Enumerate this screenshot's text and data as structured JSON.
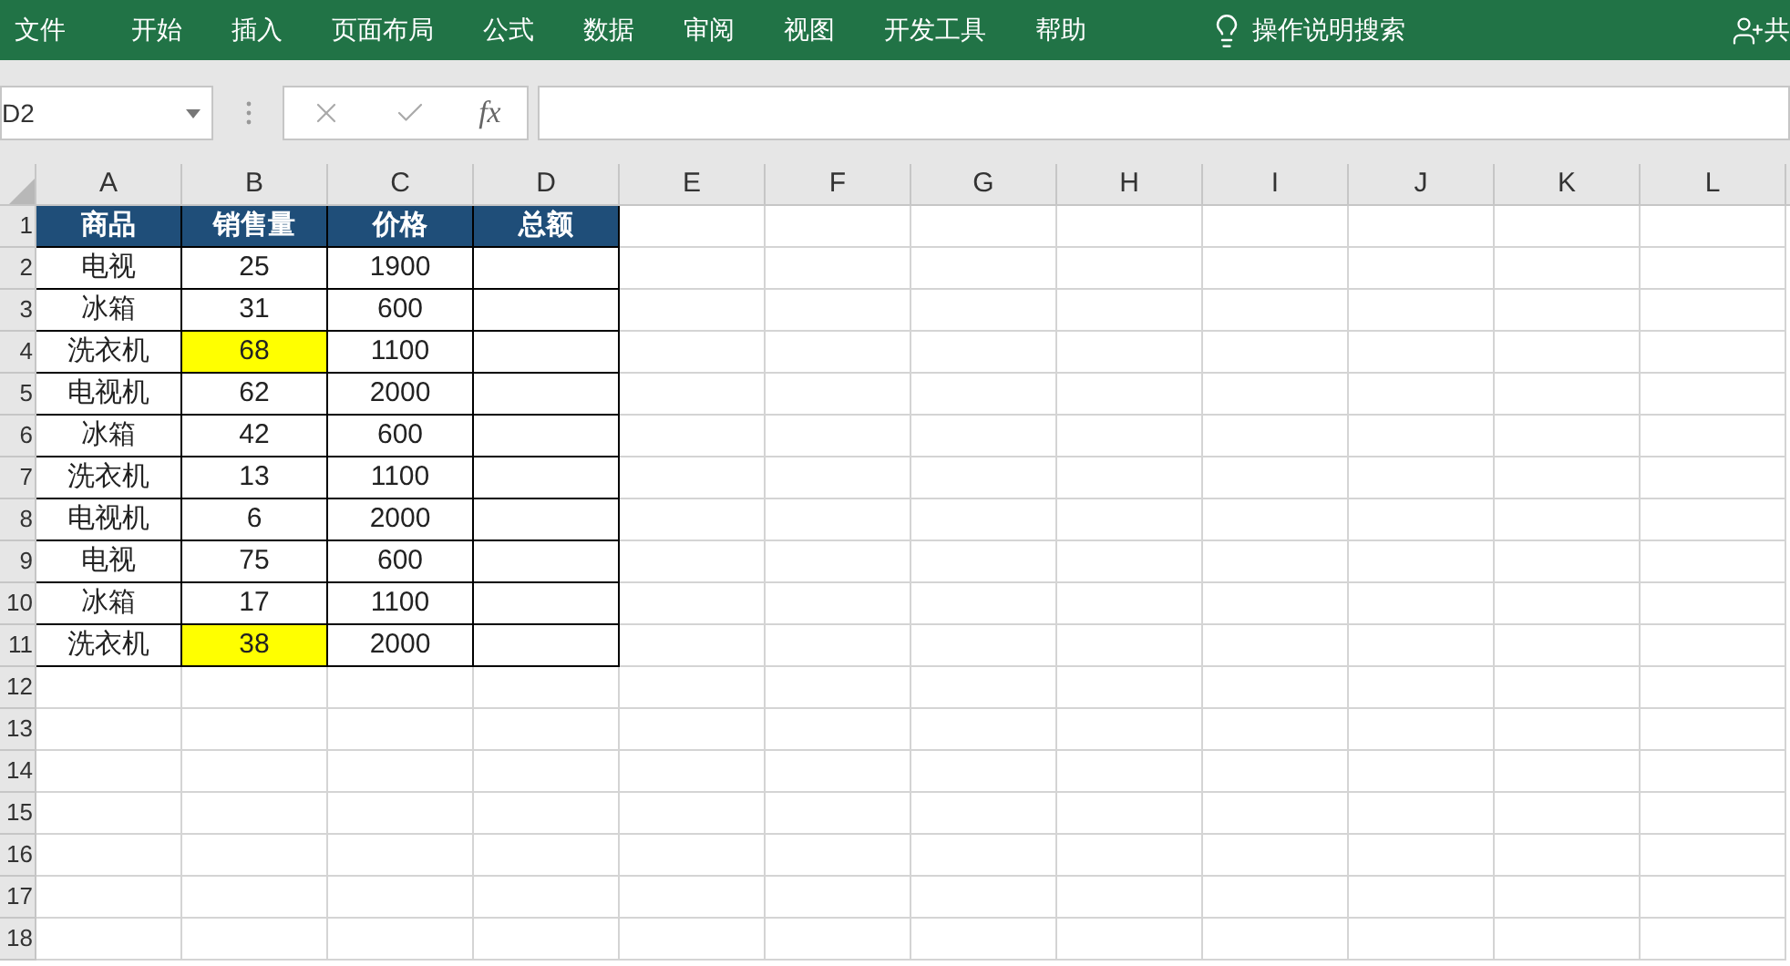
{
  "menu": [
    "文件",
    "开始",
    "插入",
    "页面布局",
    "公式",
    "数据",
    "审阅",
    "视图",
    "开发工具",
    "帮助"
  ],
  "tell_me": "操作说明搜索",
  "share": "共",
  "name_box": "D2",
  "function_label": "fx",
  "columns": [
    "A",
    "B",
    "C",
    "D",
    "E",
    "F",
    "G",
    "H",
    "I",
    "J",
    "K",
    "L"
  ],
  "header_row": {
    "number": "1",
    "cells": [
      "商品",
      "销售量",
      "价格",
      "总额"
    ]
  },
  "rows": [
    {
      "number": "2",
      "cells": [
        {
          "text": "电视",
          "highlighted": false
        },
        {
          "text": "25",
          "highlighted": false
        },
        {
          "text": "1900",
          "highlighted": false
        }
      ]
    },
    {
      "number": "3",
      "cells": [
        {
          "text": "冰箱",
          "highlighted": false
        },
        {
          "text": "31",
          "highlighted": false
        },
        {
          "text": "600",
          "highlighted": false
        }
      ]
    },
    {
      "number": "4",
      "cells": [
        {
          "text": "洗衣机",
          "highlighted": false
        },
        {
          "text": "68",
          "highlighted": true
        },
        {
          "text": "1100",
          "highlighted": false
        }
      ]
    },
    {
      "number": "5",
      "cells": [
        {
          "text": "电视机",
          "highlighted": false
        },
        {
          "text": "62",
          "highlighted": false
        },
        {
          "text": "2000",
          "highlighted": false
        }
      ]
    },
    {
      "number": "6",
      "cells": [
        {
          "text": "冰箱",
          "highlighted": false
        },
        {
          "text": "42",
          "highlighted": false
        },
        {
          "text": "600",
          "highlighted": false
        }
      ]
    },
    {
      "number": "7",
      "cells": [
        {
          "text": "洗衣机",
          "highlighted": false
        },
        {
          "text": "13",
          "highlighted": false
        },
        {
          "text": "1100",
          "highlighted": false
        }
      ]
    },
    {
      "number": "8",
      "cells": [
        {
          "text": "电视机",
          "highlighted": false
        },
        {
          "text": "6",
          "highlighted": false
        },
        {
          "text": "2000",
          "highlighted": false
        }
      ]
    },
    {
      "number": "9",
      "cells": [
        {
          "text": "电视",
          "highlighted": false
        },
        {
          "text": "75",
          "highlighted": false
        },
        {
          "text": "600",
          "highlighted": false
        }
      ]
    },
    {
      "number": "10",
      "cells": [
        {
          "text": "冰箱",
          "highlighted": false
        },
        {
          "text": "17",
          "highlighted": false
        },
        {
          "text": "1100",
          "highlighted": false
        }
      ]
    },
    {
      "number": "11",
      "cells": [
        {
          "text": "洗衣机",
          "highlighted": false
        },
        {
          "text": "38",
          "highlighted": true
        },
        {
          "text": "2000",
          "highlighted": false
        }
      ]
    }
  ],
  "empty_rows": [
    "12",
    "13",
    "14",
    "15",
    "16",
    "17",
    "18"
  ]
}
